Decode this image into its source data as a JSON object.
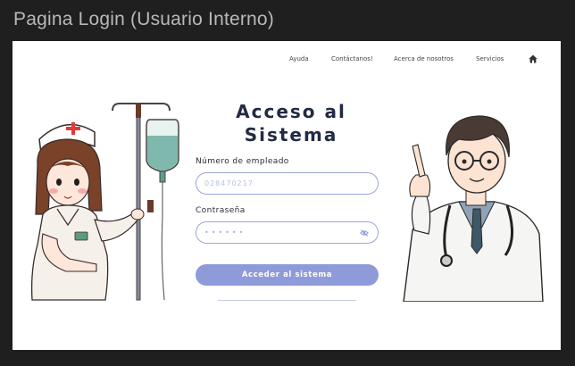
{
  "window": {
    "title": "Pagina Login (Usuario Interno)"
  },
  "nav": {
    "items": [
      "Ayuda",
      "Contáctanos!",
      "Acerca de nosotros",
      "Servicios"
    ],
    "home_icon": "home-icon"
  },
  "login": {
    "title_line1": "Acceso al",
    "title_line2": "Sistema",
    "employee_label": "Número de empleado",
    "employee_value": "028470217",
    "password_label": "Contraseña",
    "password_value": "••••••",
    "toggle_icon": "eye-slash-icon",
    "submit_label": "Acceder al sistema"
  },
  "colors": {
    "background": "#1f1f1f",
    "panel": "#ffffff",
    "accent": "#8f9bd9",
    "input_border": "#9aa6d8",
    "title": "#222a44"
  }
}
